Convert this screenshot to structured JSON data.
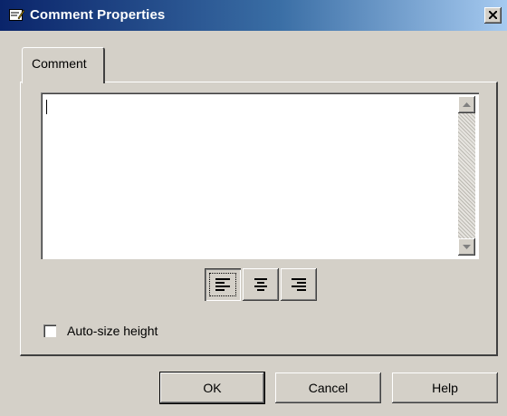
{
  "window": {
    "title": "Comment Properties",
    "title_icon": "comment-properties-icon",
    "close_icon": "close-icon"
  },
  "tabs": [
    {
      "label": "Comment",
      "active": true
    }
  ],
  "comment": {
    "value": ""
  },
  "alignment": {
    "options": [
      {
        "name": "align-left-icon",
        "selected": true
      },
      {
        "name": "align-center-icon",
        "selected": false
      },
      {
        "name": "align-right-icon",
        "selected": false
      }
    ]
  },
  "auto_size": {
    "label": "Auto-size height",
    "checked": false
  },
  "buttons": {
    "ok": "OK",
    "cancel": "Cancel",
    "help": "Help"
  }
}
